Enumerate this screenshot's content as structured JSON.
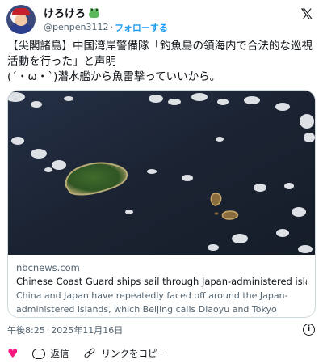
{
  "author": {
    "display_name": "けろけろ",
    "name_emoji_icon": "frog-icon",
    "handle": "@penpen3112",
    "separator": "·",
    "follow_label": "フォローする"
  },
  "platform_icon": "x-logo-icon",
  "tweet": {
    "text": "【尖閣諸島】中国湾岸警備隊「釣魚島の領海内で合法的な巡視活動を行った」と声明\n(´・ω・`)潜水艦から魚雷撃っていいから。"
  },
  "link_card": {
    "image_icon": "satellite-islands-image",
    "domain": "nbcnews.com",
    "title": "Chinese Coast Guard ships sail through Japan-administered islands as te...",
    "description": "China and Japan have repeatedly faced off around the Japan-administered islands, which Beijing calls Diaoyu and Tokyo calls the ..."
  },
  "timestamp": {
    "time": "午後8:25",
    "separator": "·",
    "date": "2025年11月16日",
    "info_icon_glyph": "i"
  },
  "actions": {
    "like_icon_glyph": "♥",
    "reply_label": "返信",
    "copy_link_label": "リンクをコピー"
  },
  "colors": {
    "accent": "#1d9bf0",
    "like": "#f91880",
    "muted_text": "#536471",
    "sea": "#1c2534"
  }
}
